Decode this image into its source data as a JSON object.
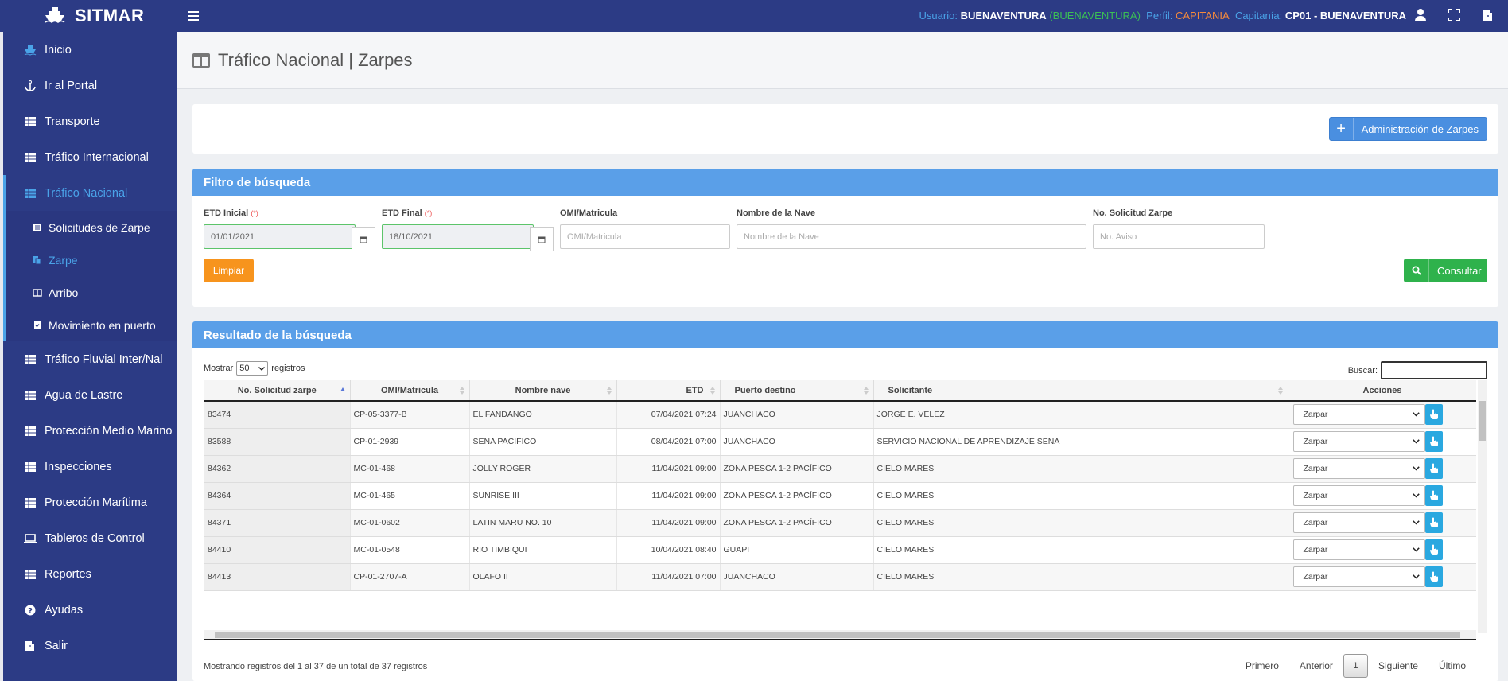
{
  "app": {
    "brand": "SITMAR",
    "user": {
      "usuario_label": "Usuario:",
      "usuario_value": "BUENAVENTURA",
      "usuario_paren": "(BUENAVENTURA)",
      "perfil_label": "Perfil:",
      "perfil_value": "CAPITANIA",
      "capitania_label": "Capitanía:",
      "capitania_value": "CP01 - BUENAVENTURA"
    }
  },
  "sidebar": {
    "items": [
      {
        "label": "Inicio",
        "icon": "ship-icon"
      },
      {
        "label": "Ir al Portal",
        "icon": "anchor-icon"
      },
      {
        "label": "Transporte",
        "icon": "table-icon"
      },
      {
        "label": "Tráfico Internacional",
        "icon": "table-icon"
      },
      {
        "label": "Tráfico Nacional",
        "icon": "table-icon"
      },
      {
        "label": "Tráfico Fluvial Inter/Nal",
        "icon": "table-icon"
      },
      {
        "label": "Agua de Lastre",
        "icon": "table-icon"
      },
      {
        "label": "Protección Medio Marino",
        "icon": "table-icon"
      },
      {
        "label": "Inspecciones",
        "icon": "table-icon"
      },
      {
        "label": "Protección Marítima",
        "icon": "table-icon"
      },
      {
        "label": "Tableros de Control",
        "icon": "laptop-icon"
      },
      {
        "label": "Reportes",
        "icon": "table-icon"
      },
      {
        "label": "Ayudas",
        "icon": "question-icon"
      },
      {
        "label": "Salir",
        "icon": "exit-icon"
      }
    ],
    "sub_items": [
      {
        "label": "Solicitudes de Zarpe"
      },
      {
        "label": "Zarpe"
      },
      {
        "label": "Arribo"
      },
      {
        "label": "Movimiento en puerto"
      }
    ]
  },
  "page": {
    "title": "Tráfico Nacional | Zarpes"
  },
  "toolbar": {
    "admin_label": "Administración de Zarpes"
  },
  "filter": {
    "header": "Filtro de búsqueda",
    "req_mark": "(*)",
    "etd_inicial_label": "ETD Inicial",
    "etd_inicial_value": "01/01/2021",
    "etd_final_label": "ETD Final",
    "etd_final_value": "18/10/2021",
    "omi_label": "OMI/Matricula",
    "omi_placeholder": "OMI/Matricula",
    "nave_label": "Nombre de la Nave",
    "nave_placeholder": "Nombre de la Nave",
    "solicitud_label": "No. Solicitud Zarpe",
    "solicitud_placeholder": "No. Aviso",
    "clear_label": "Limpiar",
    "search_label": "Consultar"
  },
  "results": {
    "header": "Resultado de la búsqueda",
    "show_label": "Mostrar",
    "page_size": "50",
    "records_label": "registros",
    "search_label": "Buscar:",
    "columns": [
      "No. Solicitud zarpe",
      "OMI/Matricula",
      "Nombre nave",
      "ETD",
      "Puerto destino",
      "Solicitante",
      "Acciones"
    ],
    "rows": [
      [
        "83474",
        "CP-05-3377-B",
        "EL FANDANGO",
        "07/04/2021 07:24",
        "JUANCHACO",
        "JORGE E. VELEZ",
        "Zarpar"
      ],
      [
        "83588",
        "CP-01-2939",
        "SENA PACIFICO",
        "08/04/2021 07:00",
        "JUANCHACO",
        "SERVICIO NACIONAL DE APRENDIZAJE SENA",
        "Zarpar"
      ],
      [
        "84362",
        "MC-01-468",
        "JOLLY ROGER",
        "11/04/2021 09:00",
        "ZONA PESCA 1-2 PACÍFICO",
        "CIELO MARES",
        "Zarpar"
      ],
      [
        "84364",
        "MC-01-465",
        "SUNRISE III",
        "11/04/2021 09:00",
        "ZONA PESCA 1-2 PACÍFICO",
        "CIELO MARES",
        "Zarpar"
      ],
      [
        "84371",
        "MC-01-0602",
        "LATIN MARU NO. 10",
        "11/04/2021 09:00",
        "ZONA PESCA 1-2 PACÍFICO",
        "CIELO MARES",
        "Zarpar"
      ],
      [
        "84410",
        "MC-01-0548",
        "RIO TIMBIQUI",
        "10/04/2021 08:40",
        "GUAPI",
        "CIELO MARES",
        "Zarpar"
      ],
      [
        "84413",
        "CP-01-2707-A",
        "OLAFO II",
        "11/04/2021 07:00",
        "JUANCHACO",
        "CIELO MARES",
        "Zarpar"
      ]
    ],
    "info": "Mostrando registros del 1 al 37 de un total de 37 registros",
    "pager": {
      "first": "Primero",
      "prev": "Anterior",
      "current": "1",
      "next": "Siguiente",
      "last": "Último"
    }
  },
  "colors": {
    "navy": "#2c3b85",
    "blue": "#5a9fe8",
    "orange": "#f7941d",
    "green": "#2fb24c",
    "cyan": "#2aa8e0"
  }
}
